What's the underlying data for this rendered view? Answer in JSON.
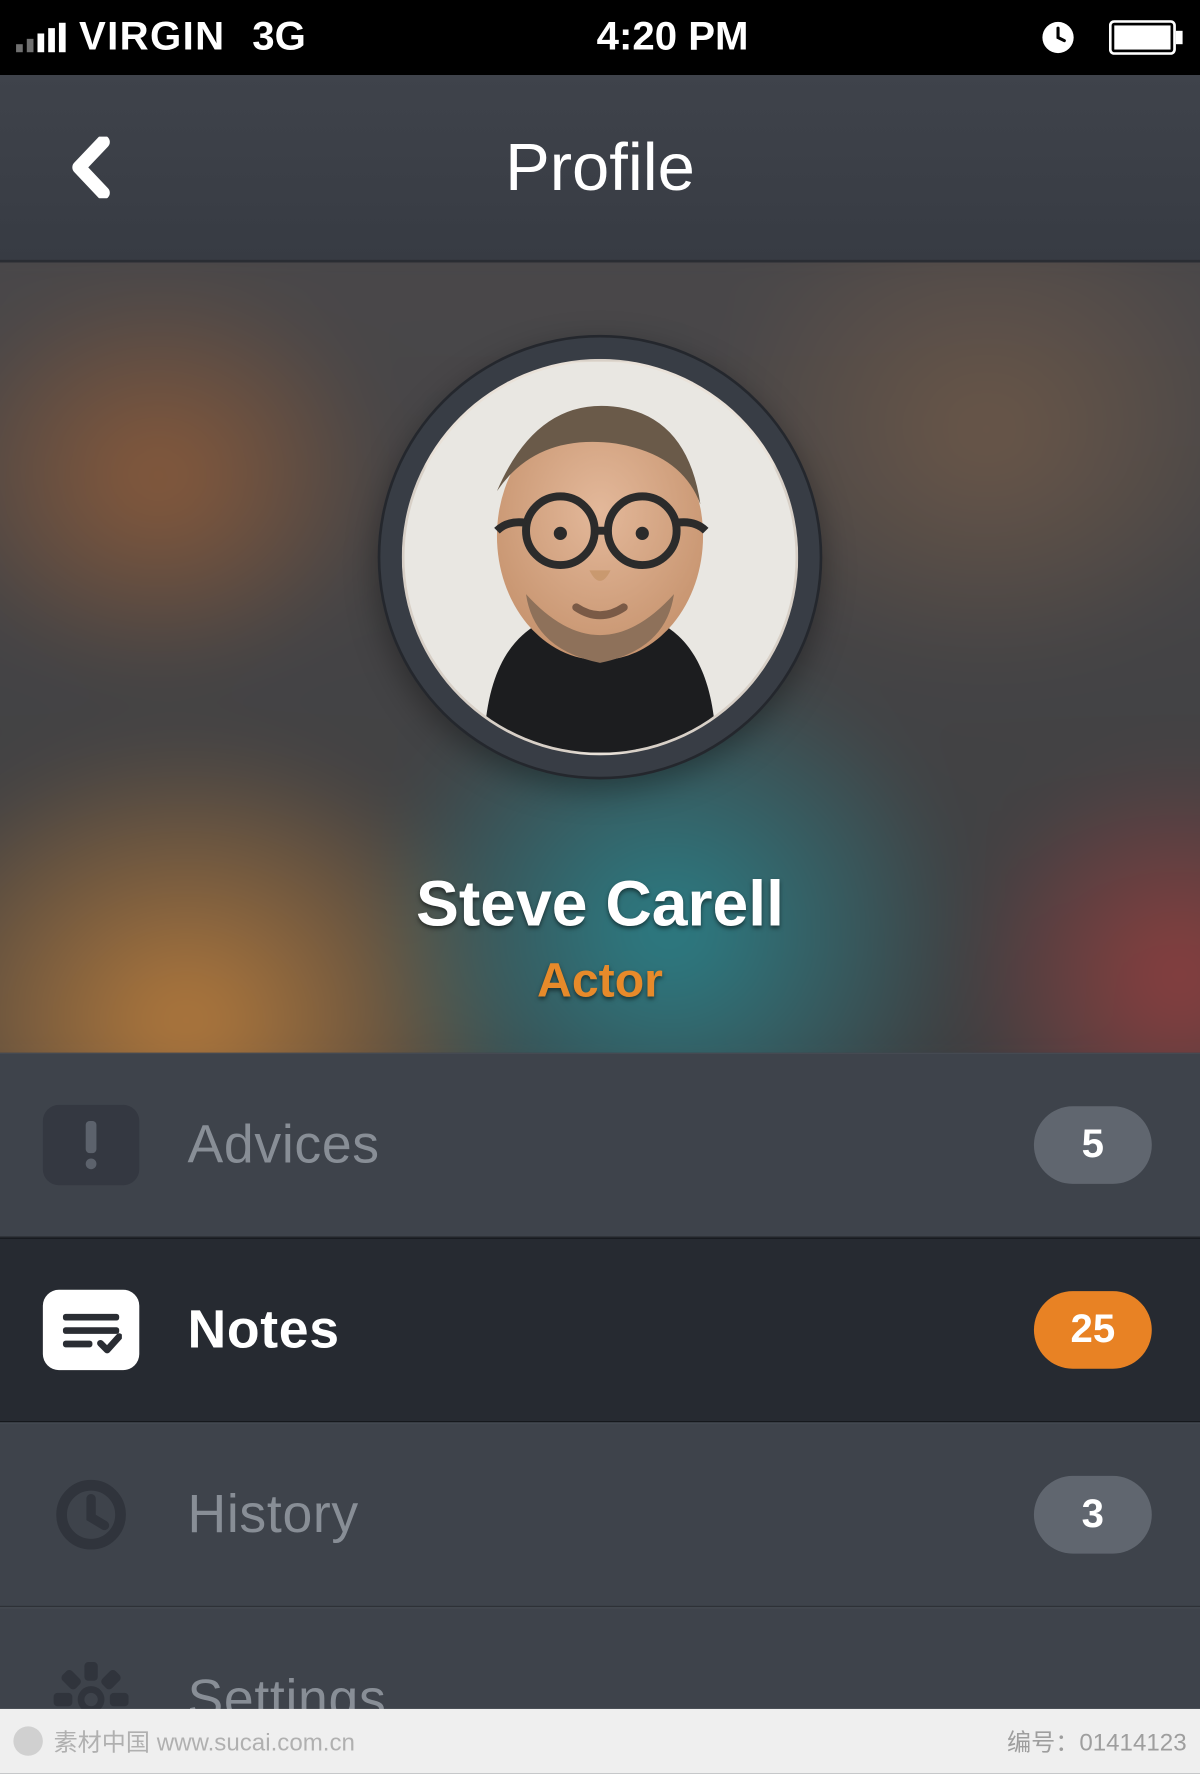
{
  "status": {
    "carrier": "VIRGIN",
    "network": "3G",
    "time": "4:20 PM"
  },
  "header": {
    "title": "Profile"
  },
  "profile": {
    "name": "Steve Carell",
    "role": "Actor"
  },
  "menu": {
    "items": [
      {
        "label": "Advices",
        "badge": "5",
        "active": false
      },
      {
        "label": "Notes",
        "badge": "25",
        "active": true
      },
      {
        "label": "History",
        "badge": "3",
        "active": false
      },
      {
        "label": "Settings",
        "badge": "",
        "active": false
      }
    ]
  },
  "footer": {
    "watermark": "素材中国  www.sucai.com.cn",
    "code_label": "编号：",
    "code": "01414123"
  }
}
